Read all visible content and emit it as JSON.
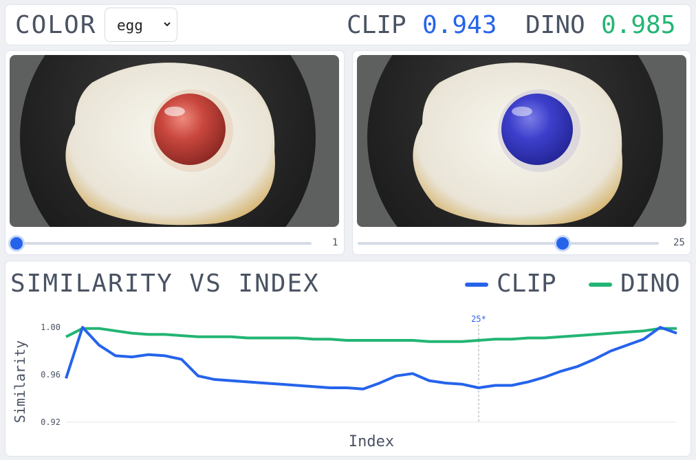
{
  "header": {
    "color_label": "COLOR",
    "select": {
      "value": "egg",
      "options": [
        "egg"
      ]
    },
    "metrics": [
      {
        "name": "CLIP",
        "value": "0.943",
        "color": "#2563eb"
      },
      {
        "name": "DINO",
        "value": "0.985",
        "color": "#22b573"
      }
    ]
  },
  "left": {
    "image_desc_icon": "egg-red-yolk-image",
    "slider": {
      "value": "1",
      "min": 1,
      "max": 41,
      "current": 1
    }
  },
  "right": {
    "image_desc_icon": "egg-blue-yolk-image",
    "slider": {
      "value": "25",
      "min": 1,
      "max": 41,
      "current": 25
    }
  },
  "chart_title": "SIMILARITY VS INDEX",
  "legend": [
    {
      "name": "CLIP",
      "color": "#2563eb"
    },
    {
      "name": "DINO",
      "color": "#22b573"
    }
  ],
  "chart_data": {
    "type": "line",
    "xlabel": "Index",
    "ylabel": "Similarity",
    "ylim": [
      0.92,
      1.0
    ],
    "yticks": [
      "1.00",
      "0.96",
      "0.92"
    ],
    "marker": {
      "x": 25,
      "label": "25*"
    },
    "x": [
      0,
      1,
      2,
      3,
      4,
      5,
      6,
      7,
      8,
      9,
      10,
      11,
      12,
      13,
      14,
      15,
      16,
      17,
      18,
      19,
      20,
      21,
      22,
      23,
      24,
      25,
      26,
      27,
      28,
      29,
      30,
      31,
      32,
      33,
      34,
      35,
      36,
      37
    ],
    "series": [
      {
        "name": "CLIP",
        "color": "#2563eb",
        "values": [
          0.957,
          1.0,
          0.985,
          0.976,
          0.975,
          0.977,
          0.976,
          0.973,
          0.959,
          0.956,
          0.955,
          0.954,
          0.953,
          0.952,
          0.951,
          0.95,
          0.949,
          0.949,
          0.948,
          0.953,
          0.959,
          0.961,
          0.955,
          0.953,
          0.952,
          0.949,
          0.951,
          0.951,
          0.954,
          0.958,
          0.963,
          0.967,
          0.973,
          0.98,
          0.985,
          0.99,
          1.0,
          0.995
        ]
      },
      {
        "name": "DINO",
        "color": "#22b573",
        "values": [
          0.992,
          0.999,
          0.999,
          0.997,
          0.995,
          0.994,
          0.994,
          0.993,
          0.992,
          0.992,
          0.992,
          0.991,
          0.991,
          0.991,
          0.991,
          0.99,
          0.99,
          0.989,
          0.989,
          0.989,
          0.989,
          0.989,
          0.988,
          0.988,
          0.988,
          0.989,
          0.99,
          0.99,
          0.991,
          0.991,
          0.992,
          0.993,
          0.994,
          0.995,
          0.996,
          0.997,
          0.999,
          0.999
        ]
      }
    ]
  }
}
